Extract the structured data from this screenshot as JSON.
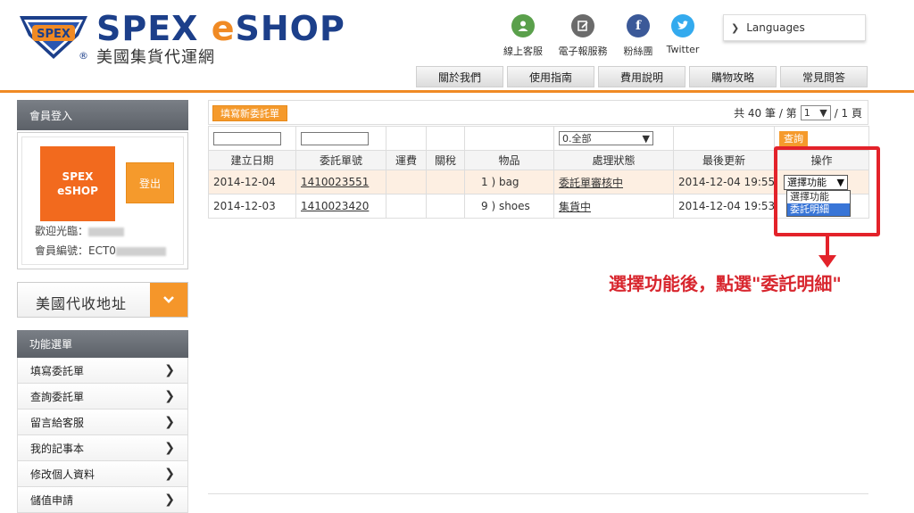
{
  "header": {
    "brand_part1": "SPEX ",
    "brand_e": "e",
    "brand_part2": "SHOP",
    "reg_mark": "®",
    "tagline": "美國集貨代運網",
    "logo_text": "SPEX",
    "social": [
      {
        "label": "線上客服",
        "icon": "person-icon",
        "color": "#5aa04b",
        "glyph": "●"
      },
      {
        "label": "電子報服務",
        "icon": "newsletter-icon",
        "color": "#6b6b6b",
        "glyph": "✎"
      },
      {
        "label": "粉絲團",
        "icon": "facebook-icon",
        "color": "#3b5998",
        "glyph": "f"
      },
      {
        "label": "Twitter",
        "icon": "twitter-icon",
        "color": "#33aaee",
        "glyph": "t"
      }
    ],
    "languages_label": "Languages",
    "nav": [
      "關於我們",
      "使用指南",
      "費用說明",
      "購物攻略",
      "常見問答"
    ]
  },
  "sidebar": {
    "login_title": "會員登入",
    "avatar_line1": "SPEX",
    "avatar_line2": "eSHOP",
    "logout_label": "登出",
    "welcome_label": "歡迎光臨：",
    "member_id_label": "會員編號：ECT0",
    "address_label": "美國代收地址",
    "menu_title": "功能選單",
    "menu_items": [
      "填寫委託單",
      "查詢委託單",
      "留言給客服",
      "我的記事本",
      "修改個人資料",
      "儲值申請"
    ]
  },
  "main": {
    "new_order_label": "填寫新委託單",
    "pager_prefix": "共 40 筆 / 第",
    "pager_page": "1",
    "pager_suffix": "/ 1 頁",
    "status_filter": "0.全部",
    "query_label": "查詢",
    "columns": [
      "建立日期",
      "委託單號",
      "運費",
      "關稅",
      "物品",
      "處理狀態",
      "最後更新",
      "操作"
    ],
    "rows": [
      {
        "created": "2014-12-04",
        "order_no": "1410023551",
        "shipping": "",
        "tax": "",
        "item": "1 ) bag",
        "status": "委託單審核中",
        "updated": "2014-12-04 19:55",
        "action": "選擇功能"
      },
      {
        "created": "2014-12-03",
        "order_no": "1410023420",
        "shipping": "",
        "tax": "",
        "item": "9 ) shoes",
        "status": "集貨中",
        "updated": "2014-12-04 19:53",
        "action": ""
      }
    ],
    "dropdown_options": [
      "選擇功能",
      "委託明細"
    ]
  },
  "annotation": {
    "text": "選擇功能後，點選\"委託明細\"",
    "color": "#e3222a"
  }
}
